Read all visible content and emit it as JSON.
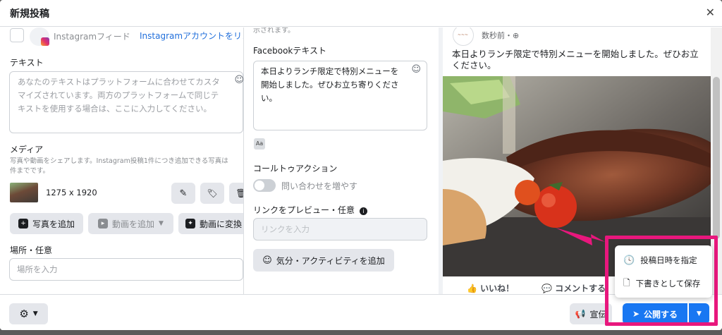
{
  "header": {
    "title": "新規投稿",
    "close": "✕"
  },
  "left": {
    "ig_feed_label": "Instagramフィード",
    "ig_link_label": "Instagramアカウントをリン",
    "text_title": "テキスト",
    "text_placeholder_1": "あなたのテキストはプラットフォームに合わせてカスタ",
    "text_placeholder_2": "マイズされています。両方のプラットフォームで同じテ",
    "text_placeholder_3": "キストを使用する場合は、ここに入力してください。",
    "media_title": "メディア",
    "media_desc_1": "写真や動画をシェアします。Instagram投稿1件につき追加できる写真は",
    "media_desc_2": "件までです。",
    "media_size": "1275 x 1920",
    "add_photo": "写真を追加",
    "add_video": "動画を追加",
    "convert_video": "動画に変換",
    "location_title": "場所・任意",
    "location_placeholder": "場所を入力"
  },
  "mid": {
    "top_fragment": "示されます。",
    "fb_text_title": "Facebookテキスト",
    "fb_text_1": "本日よりランチ限定で特別メニューを",
    "fb_text_2": "開始しました。ぜひお立ち寄りくださ",
    "fb_text_3": "い。",
    "aa": "Aa",
    "cta_title": "コールトゥアクション",
    "cta_toggle_label": "問い合わせを増やす",
    "link_preview_title": "リンクをプレビュー・任意",
    "link_placeholder": "リンクを入力",
    "feeling_button": "気分・アクティビティを追加"
  },
  "preview": {
    "timestamp": "数秒前・",
    "text_1": "本日よりランチ限定で特別メニューを開始しました。ぜひお立",
    "text_2": "ください。",
    "like": "いいね！",
    "comment": "コメントする"
  },
  "dropdown": {
    "schedule": "投稿日時を指定",
    "save_draft": "下書きとして保存"
  },
  "footer": {
    "boost": "宣伝",
    "publish": "公開する"
  },
  "colors": {
    "accent": "#1877f2",
    "highlight": "#e8177d"
  }
}
